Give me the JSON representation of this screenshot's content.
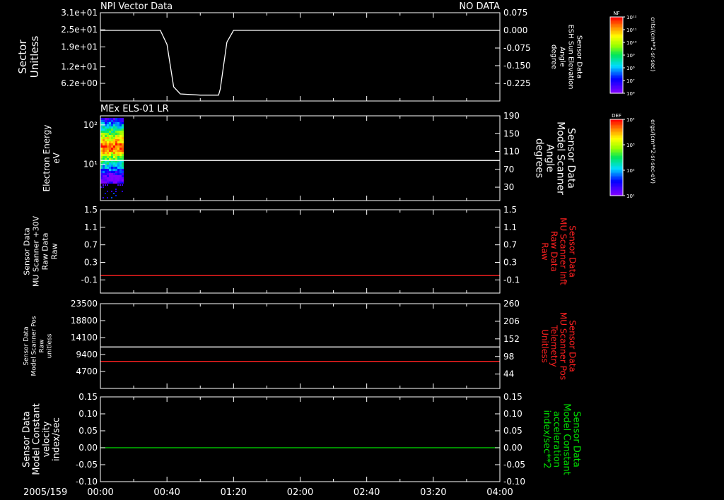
{
  "colors": {
    "background": "#000000",
    "axes": "#ffffff",
    "red_trace": "#ff2020",
    "green_trace": "#00e000"
  },
  "header": {
    "left_title": "NPI Vector Data",
    "right_title": "NO DATA"
  },
  "panel2_title": "MEx ELS-01 LR",
  "time_axis": {
    "date_label": "2005/159",
    "tick_labels": [
      "00:00",
      "00:40",
      "01:20",
      "02:00",
      "02:40",
      "03:20",
      "04:00"
    ],
    "tick_values_min": [
      0,
      40,
      80,
      120,
      160,
      200,
      240
    ],
    "range_min": [
      0,
      240
    ]
  },
  "colorbars": [
    {
      "title": "NF",
      "unit_label": "cnts/(cm**2-sr-sec)",
      "tick_labels": [
        "10¹²",
        "10¹¹",
        "10¹⁰",
        "10⁹",
        "10⁸",
        "10⁷",
        "10⁶"
      ]
    },
    {
      "title": "DEF",
      "unit_label": "ergs/(cm**2-sr-sec-eV)",
      "tick_labels": [
        "10⁴",
        "10³",
        "10²",
        "10¹"
      ]
    }
  ],
  "chart_data": [
    {
      "type": "line",
      "panel": 1,
      "left_axis": {
        "label": [
          "Sector",
          "Unitless"
        ],
        "tick_labels": [
          "3.1e+01",
          "2.5e+01",
          "1.9e+01",
          "1.2e+01",
          "6.2e+00"
        ],
        "tick_values": [
          31,
          25,
          19,
          12,
          6.2
        ],
        "range": [
          0,
          31
        ]
      },
      "right_axis": {
        "label": [
          "Sensor Data",
          "ESH Sun Elevation",
          "Angle",
          "degree"
        ],
        "tick_labels": [
          "0.075",
          "0.000",
          "-0.075",
          "-0.150",
          "-0.225"
        ],
        "tick_values": [
          0.075,
          0.0,
          -0.075,
          -0.15,
          -0.225
        ],
        "range": [
          -0.3,
          0.075
        ]
      },
      "series": [
        {
          "axis": "right",
          "color": "#ffffff",
          "x_min": [
            0,
            36,
            40,
            44,
            48,
            60,
            71,
            72,
            76,
            80,
            240
          ],
          "y": [
            0.0,
            0.0,
            -0.06,
            -0.24,
            -0.27,
            -0.275,
            -0.275,
            -0.25,
            -0.05,
            0.0,
            0.0
          ]
        }
      ]
    },
    {
      "type": "heatmap",
      "panel": 2,
      "left_axis": {
        "label": [
          "Electron Energy",
          "eV"
        ],
        "scale": "log",
        "tick_labels": [
          "10²",
          "10¹"
        ],
        "tick_values": [
          100,
          10
        ],
        "range": [
          1.2,
          170
        ]
      },
      "right_axis": {
        "label": [
          "Sensor Data",
          "Model Scanner",
          "Angle",
          "degrees"
        ],
        "tick_labels": [
          "190",
          "150",
          "110",
          "70",
          "30"
        ],
        "tick_values": [
          190,
          150,
          110,
          70,
          30
        ],
        "range": [
          0,
          190
        ]
      },
      "spectrogram_extent_min": [
        0,
        13
      ],
      "series": [
        {
          "axis": "right",
          "color": "#ffffff",
          "x_min": [
            0,
            240
          ],
          "y": [
            90,
            90
          ]
        }
      ]
    },
    {
      "type": "line",
      "panel": 3,
      "left_axis": {
        "label": [
          "Sensor Data",
          "MU Scanner +30V",
          "Raw Data",
          "Raw"
        ],
        "tick_labels": [
          "1.5",
          "1.1",
          "0.7",
          "0.3",
          "-0.1"
        ],
        "tick_values": [
          1.5,
          1.1,
          0.7,
          0.3,
          -0.1
        ],
        "range": [
          -0.4,
          1.5
        ]
      },
      "right_axis": {
        "label": [
          "Sensor Data",
          "MU Scanner Inft",
          "Raw Data",
          "Raw"
        ],
        "tick_labels": [
          "1.5",
          "1.1",
          "0.7",
          "0.3",
          "-0.1"
        ],
        "tick_values": [
          1.5,
          1.1,
          0.7,
          0.3,
          -0.1
        ],
        "range": [
          -0.4,
          1.5
        ]
      },
      "series": [
        {
          "axis": "right",
          "color": "#ff2020",
          "x_min": [
            0,
            240
          ],
          "y": [
            0.0,
            0.0
          ]
        }
      ]
    },
    {
      "type": "line",
      "panel": 4,
      "left_axis": {
        "label": [
          "Sensor Data",
          "Model Scanner Pos",
          "Raw",
          "unitless"
        ],
        "tick_labels": [
          "23500",
          "18800",
          "14100",
          "9400",
          "4700"
        ],
        "tick_values": [
          23500,
          18800,
          14100,
          9400,
          4700
        ],
        "range": [
          0,
          23500
        ]
      },
      "right_axis": {
        "label": [
          "Sensor Data",
          "MU Scanner Pos",
          "Telemetry",
          "Unitless"
        ],
        "tick_labels": [
          "260",
          "206",
          "152",
          "98",
          "44"
        ],
        "tick_values": [
          260,
          206,
          152,
          98,
          44
        ],
        "range": [
          0,
          260
        ]
      },
      "series": [
        {
          "axis": "left",
          "color": "#ffffff",
          "x_min": [
            0,
            240
          ],
          "y": [
            11500,
            11500
          ]
        },
        {
          "axis": "right",
          "color": "#ff2020",
          "x_min": [
            0,
            240
          ],
          "y": [
            83,
            83
          ]
        }
      ]
    },
    {
      "type": "line",
      "panel": 5,
      "left_axis": {
        "label": [
          "Sensor Data",
          "Model Constant",
          "velocity",
          "index/sec"
        ],
        "tick_labels": [
          "0.15",
          "0.10",
          "0.05",
          "0.00",
          "-0.05",
          "-0.10"
        ],
        "tick_values": [
          0.15,
          0.1,
          0.05,
          0.0,
          -0.05,
          -0.1
        ],
        "range": [
          -0.1,
          0.15
        ]
      },
      "right_axis": {
        "label": [
          "Sensor Data",
          "Model Constant",
          "acceleration",
          "index/sec**2"
        ],
        "tick_labels": [
          "0.15",
          "0.10",
          "0.05",
          "0.00",
          "-0.05",
          "-0.10"
        ],
        "tick_values": [
          0.15,
          0.1,
          0.05,
          0.0,
          -0.05,
          -0.1
        ],
        "range": [
          -0.1,
          0.15
        ]
      },
      "series": [
        {
          "axis": "right",
          "color": "#00e000",
          "x_min": [
            0,
            240
          ],
          "y": [
            0.0,
            0.0
          ]
        }
      ]
    }
  ]
}
